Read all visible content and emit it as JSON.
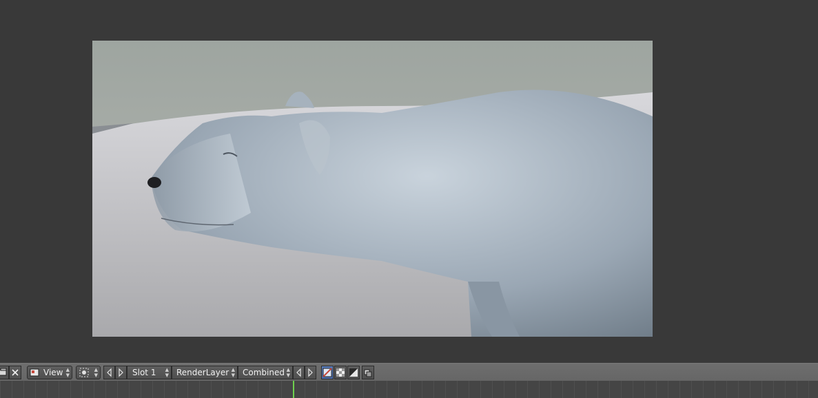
{
  "header": {
    "view_menu": "View",
    "slot": "Slot 1",
    "render_layer": "RenderLayer",
    "pass": "Combined"
  },
  "icons": {
    "image_browse": "image-browse-icon",
    "close": "close-icon",
    "view_mode": "view-mode-icon",
    "pin": "pin-icon",
    "prev": "chevron-left-icon",
    "next": "chevron-right-icon",
    "alpha_color": "color-alpha-icon",
    "alpha_only": "alpha-checker-icon",
    "z_buffer": "zbuffer-icon",
    "overlay": "overlay-icon"
  },
  "colors": {
    "background": "#393939",
    "header": "#6a6a6a",
    "accent": "#5680c2",
    "playhead": "#6fd24e"
  },
  "timeline": {
    "current_frame_fraction": 0.358
  }
}
